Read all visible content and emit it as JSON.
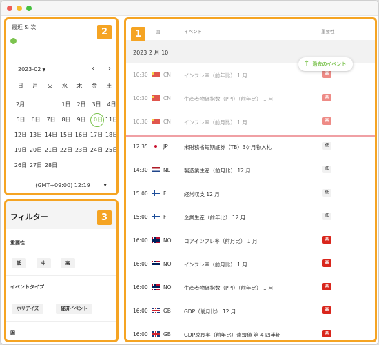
{
  "calendar": {
    "mode_label": "最近 & 次",
    "month_select": "2023-02",
    "weekdays": [
      "日",
      "月",
      "火",
      "水",
      "木",
      "金",
      "土"
    ],
    "month_label": "2月",
    "weeks": [
      [
        "",
        "",
        "",
        "1日",
        "2日",
        "3日",
        "4日"
      ],
      [
        "5日",
        "6日",
        "7日",
        "8日",
        "9日",
        "10日",
        "11日"
      ],
      [
        "12日",
        "13日",
        "14日",
        "15日",
        "16日",
        "17日",
        "18日"
      ],
      [
        "19日",
        "20日",
        "21日",
        "22日",
        "23日",
        "24日",
        "25日"
      ],
      [
        "26日",
        "27日",
        "28日",
        "",
        "",
        "",
        ""
      ]
    ],
    "today": "10日",
    "timezone": "(GMT+09:00) 12:19"
  },
  "filters": {
    "title": "フィルター",
    "importance_label": "重要性",
    "importance_options": [
      "低",
      "中",
      "高"
    ],
    "event_type_label": "イベントタイプ",
    "event_type_options": [
      "ホリデイズ",
      "経済イベント"
    ],
    "country_label": "国"
  },
  "events": {
    "col_country": "国",
    "col_event": "イベント",
    "col_importance": "重要性",
    "date_header": "2023 2 月 10",
    "past_button": "過去のイベント",
    "rows": [
      {
        "time": "10:30",
        "flag": "cn",
        "country": "CN",
        "name": "インフレ率（前年比） 1 月",
        "importance": "高",
        "level": "hi-past",
        "past": true
      },
      {
        "time": "10:30",
        "flag": "cn",
        "country": "CN",
        "name": "生産者物価指数（PPI）（前年比） 1 月",
        "importance": "高",
        "level": "hi-past",
        "past": true
      },
      {
        "time": "10:30",
        "flag": "cn",
        "country": "CN",
        "name": "インフレ率（前月比） 1 月",
        "importance": "高",
        "level": "hi-past",
        "past": true
      },
      {
        "time": "12:35",
        "flag": "jp",
        "country": "JP",
        "name": "米財務省短期証券（TB）3ケ月物入札",
        "importance": "低",
        "level": "lo",
        "past": false
      },
      {
        "time": "14:30",
        "flag": "nl",
        "country": "NL",
        "name": "製造業生産（前月比） 12 月",
        "importance": "低",
        "level": "lo",
        "past": false
      },
      {
        "time": "15:00",
        "flag": "fi",
        "country": "FI",
        "name": "経常収支 12 月",
        "importance": "低",
        "level": "lo",
        "past": false
      },
      {
        "time": "15:00",
        "flag": "fi",
        "country": "FI",
        "name": "企業生産（前年比） 12 月",
        "importance": "低",
        "level": "lo",
        "past": false
      },
      {
        "time": "16:00",
        "flag": "no",
        "country": "NO",
        "name": "コアインフレ率（前月比） 1 月",
        "importance": "高",
        "level": "hi",
        "past": false
      },
      {
        "time": "16:00",
        "flag": "no",
        "country": "NO",
        "name": "インフレ率（前月比） 1 月",
        "importance": "高",
        "level": "hi",
        "past": false
      },
      {
        "time": "16:00",
        "flag": "no",
        "country": "NO",
        "name": "生産者物価指数（PPI）（前年比） 1 月",
        "importance": "高",
        "level": "hi",
        "past": false
      },
      {
        "time": "16:00",
        "flag": "gb",
        "country": "GB",
        "name": "GDP（前月比） 12 月",
        "importance": "高",
        "level": "hi",
        "past": false
      },
      {
        "time": "16:00",
        "flag": "gb",
        "country": "GB",
        "name": "GDP成長率（前年比）速報値 第 4 四半期",
        "importance": "高",
        "level": "hi",
        "past": false
      }
    ]
  },
  "badges": {
    "events": "1",
    "calendar": "2",
    "filters": "3"
  }
}
